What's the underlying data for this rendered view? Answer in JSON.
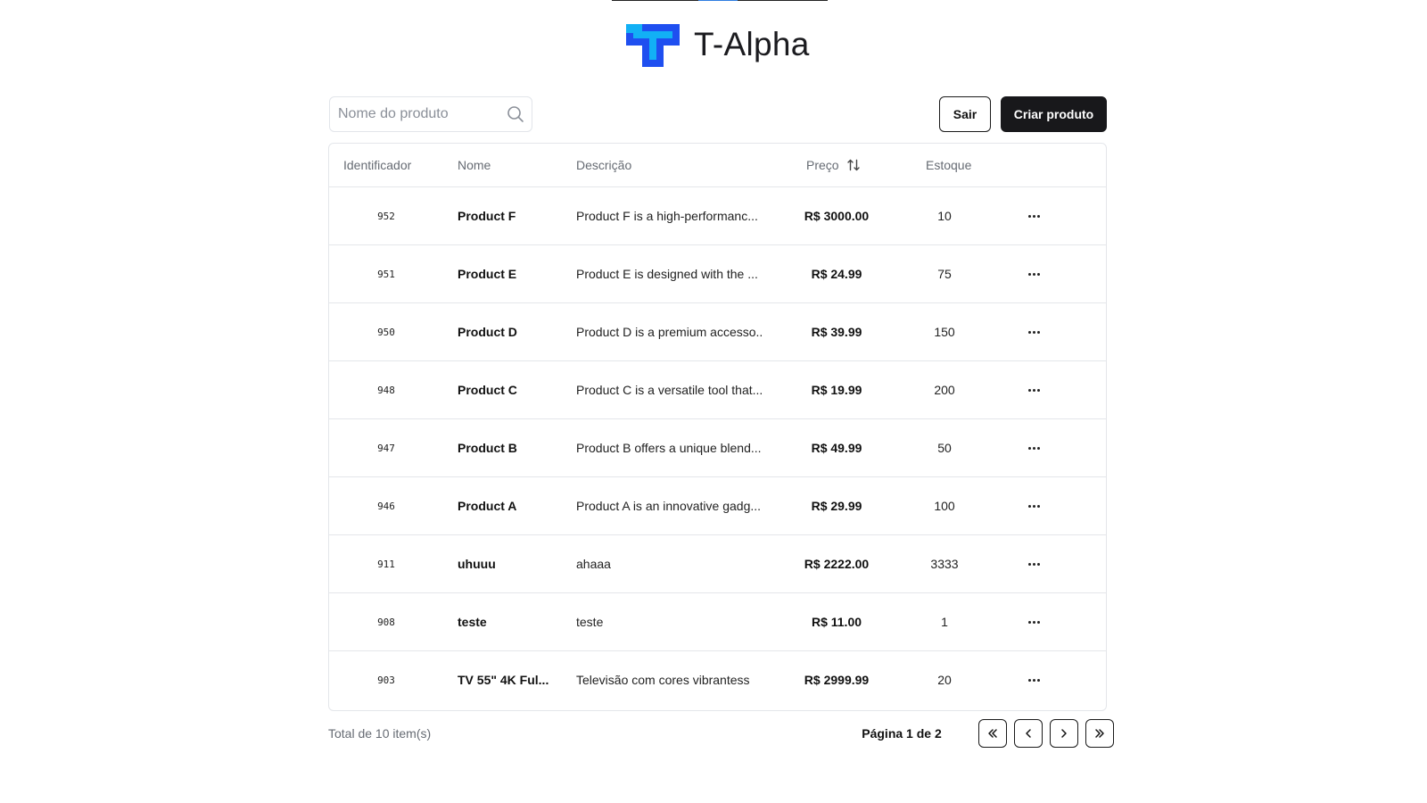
{
  "brand": {
    "name": "T-Alpha",
    "logo_icon": "t-alpha-logo-icon",
    "colors": {
      "primary": "#1f4ff0",
      "secondary": "#12b0f5"
    }
  },
  "toolbar": {
    "search_placeholder": "Nome do produto",
    "search_value": "",
    "logout_label": "Sair",
    "create_label": "Criar produto"
  },
  "table": {
    "headers": {
      "id": "Identificador",
      "name": "Nome",
      "description": "Descrição",
      "price": "Preço",
      "stock": "Estoque"
    },
    "rows": [
      {
        "id": "952",
        "name": "Product F",
        "description": "Product F is a high-performanc...",
        "price": "R$ 3000.00",
        "stock": "10"
      },
      {
        "id": "951",
        "name": "Product E",
        "description": "Product E is designed with the ...",
        "price": "R$ 24.99",
        "stock": "75"
      },
      {
        "id": "950",
        "name": "Product D",
        "description": "Product D is a premium accesso...",
        "price": "R$ 39.99",
        "stock": "150"
      },
      {
        "id": "948",
        "name": "Product C",
        "description": "Product C is a versatile tool that...",
        "price": "R$ 19.99",
        "stock": "200"
      },
      {
        "id": "947",
        "name": "Product B",
        "description": "Product B offers a unique blend...",
        "price": "R$ 49.99",
        "stock": "50"
      },
      {
        "id": "946",
        "name": "Product A",
        "description": "Product A is an innovative gadg...",
        "price": "R$ 29.99",
        "stock": "100"
      },
      {
        "id": "911",
        "name": "uhuuu",
        "description": "ahaaa",
        "price": "R$ 2222.00",
        "stock": "3333"
      },
      {
        "id": "908",
        "name": "teste",
        "description": "teste",
        "price": "R$ 11.00",
        "stock": "1"
      },
      {
        "id": "903",
        "name": "TV 55\" 4K Ful...",
        "description": "Televisão com cores vibrantess",
        "price": "R$ 2999.99",
        "stock": "20"
      }
    ]
  },
  "footer": {
    "total": "Total de 10 item(s)",
    "page": "Página 1 de 2"
  },
  "icons": {
    "search": "search-icon",
    "sort": "sort-arrows-icon",
    "row_menu": "more-horizontal-icon",
    "first_page": "chevrons-left-icon",
    "prev_page": "chevron-left-icon",
    "next_page": "chevron-right-icon",
    "last_page": "chevrons-right-icon"
  }
}
